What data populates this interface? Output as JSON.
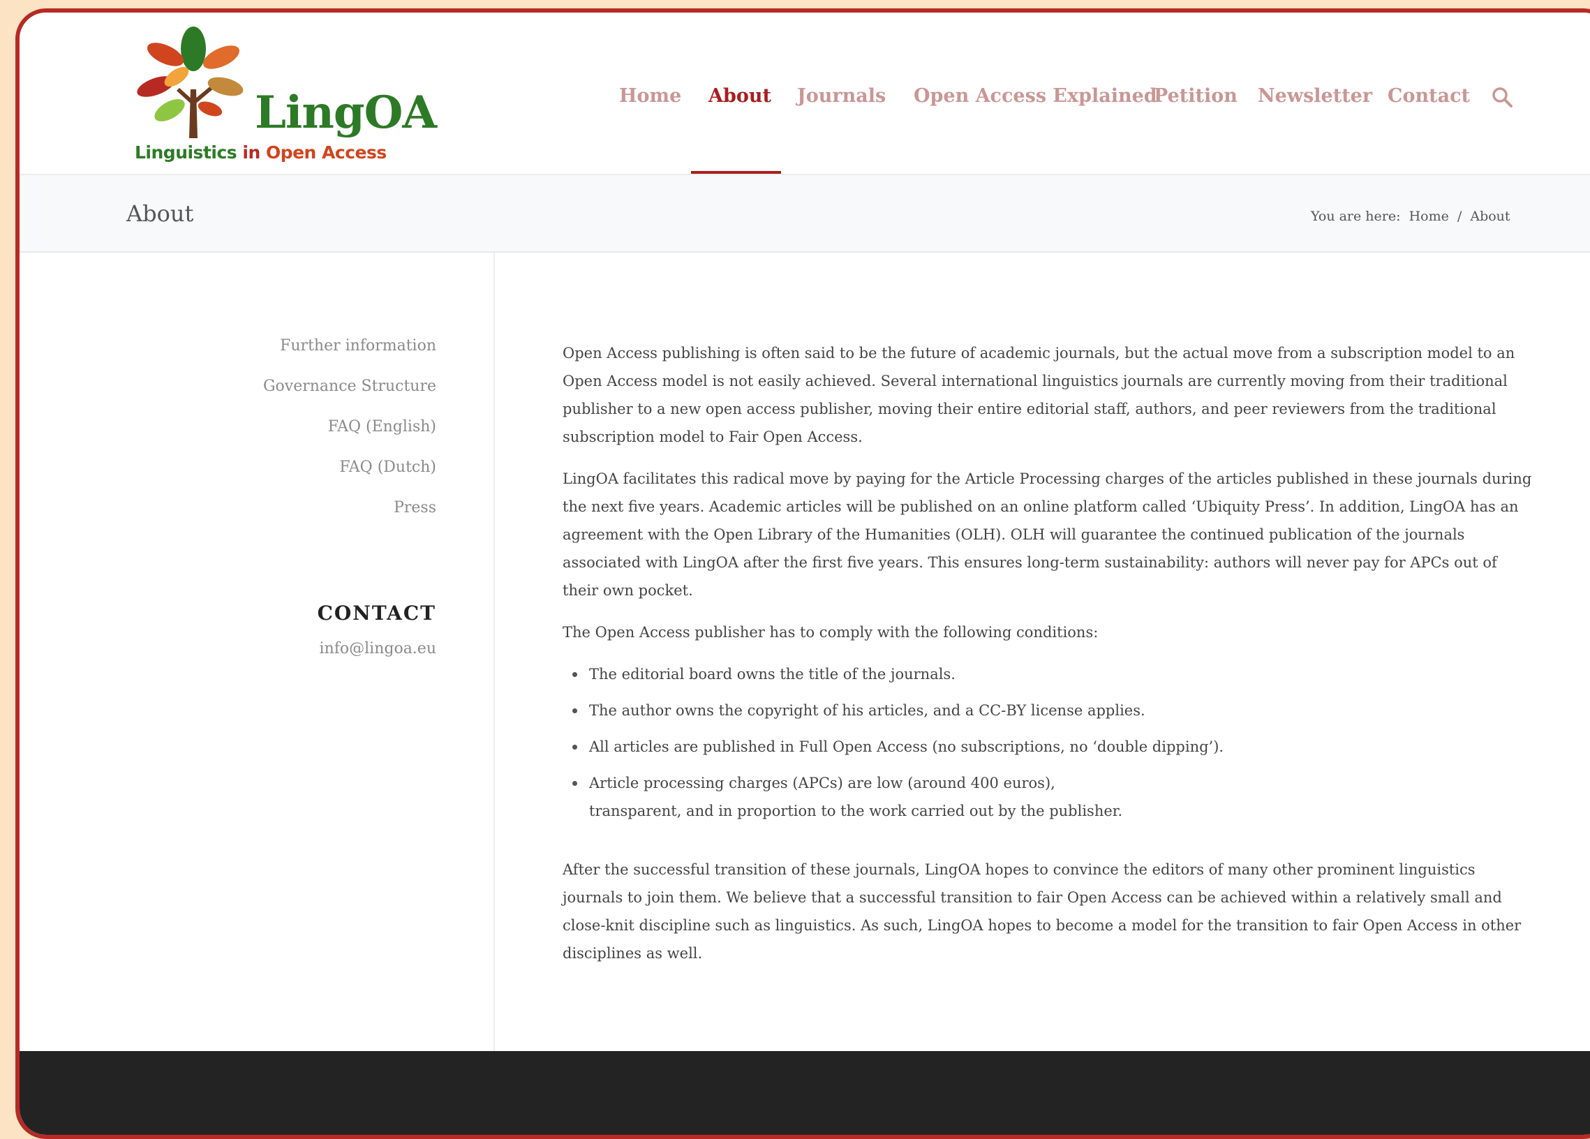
{
  "logo": {
    "wordmark": "LingOA",
    "tagline_part1": "Linguistics",
    "tagline_part2": " in ",
    "tagline_part3": "Open Access",
    "colors": [
      "#2d7a26",
      "#d0451e",
      "#b72a24",
      "#8fc641",
      "#e06b2b"
    ]
  },
  "nav": {
    "items": [
      {
        "label": "Home"
      },
      {
        "label": "About"
      },
      {
        "label": "Journals"
      },
      {
        "label": "Open Access Explained"
      },
      {
        "label": "Petition"
      },
      {
        "label": "Newsletter"
      },
      {
        "label": "Contact"
      }
    ],
    "active_color": "#a81e1e",
    "inactive_color": "#c99795",
    "search_icon": "search-icon"
  },
  "page": {
    "title": "About"
  },
  "breadcrumb": {
    "prefix": "You are here:",
    "home": "Home",
    "separator": "/",
    "current": "About"
  },
  "sidebar": {
    "links": [
      {
        "label": "Further information"
      },
      {
        "label": "Governance Structure"
      },
      {
        "label": "FAQ (English)"
      },
      {
        "label": "FAQ (Dutch)"
      },
      {
        "label": "Press"
      }
    ],
    "contact_heading": "CONTACT",
    "contact_email": "info@lingoa.eu"
  },
  "content": {
    "p1": "Open Access publishing is often said to be the future of academic journals, but the actual move from a subscription model to an Open Access model is not easily achieved. Several international linguistics journals are currently moving from their traditional publisher to a new open access publisher, moving their entire editorial staff, authors, and peer reviewers from the traditional subscription model to Fair Open Access.",
    "p2": "LingOA facilitates this radical move by paying for the Article Processing charges of the articles published in these journals during the next five years. Academic articles will be published on an online platform called ‘Ubiquity Press’. In addition, LingOA has an agreement with the Open Library of the Humanities (OLH). OLH will guarantee the continued publication of the journals associated with LingOA after the first five years. This ensures long-term sustainability: authors will never pay for APCs out of their own pocket.",
    "p3": "The Open Access publisher has to comply with the following conditions:",
    "conditions": [
      "The editorial board owns the title of the journals.",
      "The author owns the copyright of his articles, and a CC-BY license applies.",
      "All articles are published in Full Open Access (no subscriptions, no ‘double dipping’).",
      "Article processing charges (APCs) are low (around 400 euros),"
    ],
    "condition4_line2": "transparent, and in proportion to the work carried out by the publisher.",
    "p4": "After the successful transition of these journals, LingOA hopes to convince the editors of many other prominent linguistics journals to join them. We believe that a successful transition to fair Open Access can be achieved within a relatively small and close-knit discipline such as linguistics. As such, LingOA hopes to become a model for the transition to fair Open Access in other disciplines as well."
  }
}
